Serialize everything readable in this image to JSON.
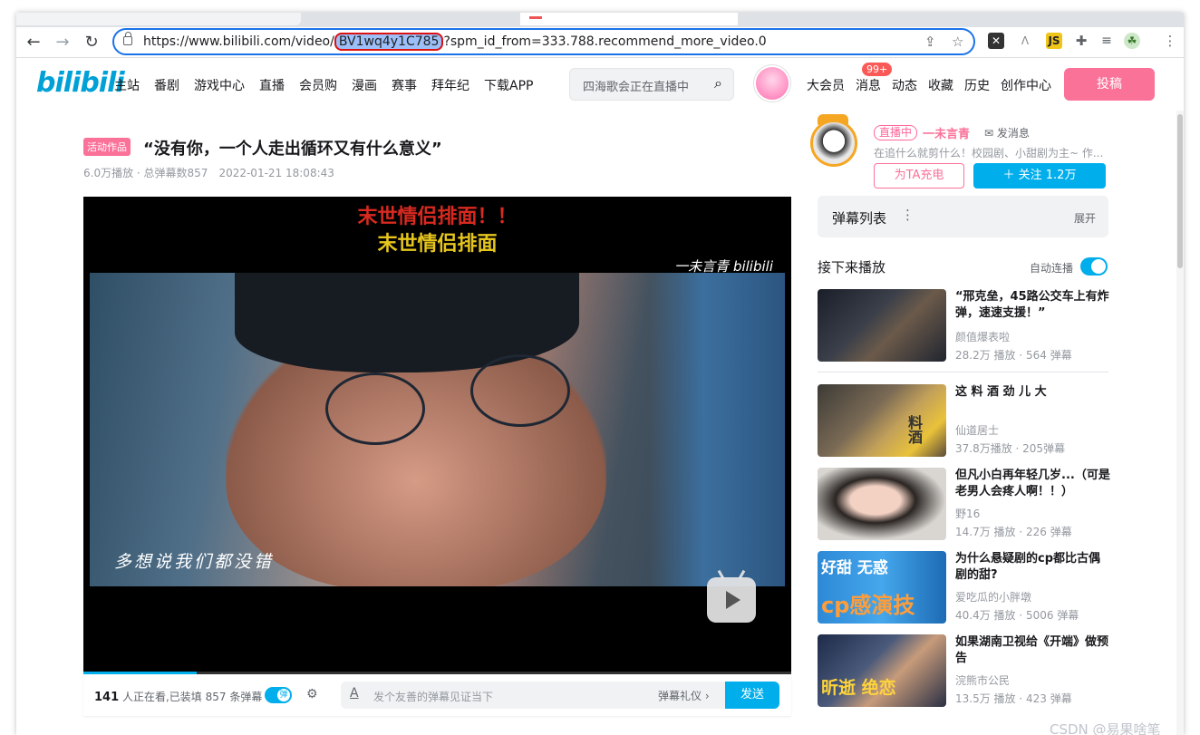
{
  "browser": {
    "url_prefix": "https://www.bilibili.com/video/",
    "url_highlight": "BV1wq4y1C785",
    "url_suffix": "?spm_id_from=333.788.recommend_more_video.0"
  },
  "header": {
    "logo": "bilibili",
    "nav": [
      "主站",
      "番剧",
      "游戏中心",
      "直播",
      "会员购",
      "漫画",
      "赛事",
      "拜年纪",
      "下载APP"
    ],
    "search_placeholder": "四海歌会正在直播中",
    "right_nav": [
      "大会员",
      "消息",
      "动态",
      "收藏",
      "历史",
      "创作中心"
    ],
    "message_badge": "99+",
    "upload": "投稿"
  },
  "video": {
    "tag": "活动作品",
    "title": "“没有你，一个人走出循环又有什么意义”",
    "views": "6.0万播放 · 总弹幕数857",
    "date": "2022-01-21 18:08:43",
    "caption_red": "末世情侣排面！！",
    "caption_yellow": "末世情侣排面",
    "watermark": "一未言青 bilibili",
    "subtitle": "多想说我们都没错",
    "progress": 0.16
  },
  "danmaku_bar": {
    "viewers_count": "141",
    "viewers_text": "人正在看,已装填 857 条弹幕",
    "toggle_label": "弹",
    "placeholder": "发个友善的弹幕见证当下",
    "etiquette": "弹幕礼仪 ›",
    "send": "发送"
  },
  "uploader": {
    "live": "直播中",
    "name": "一未言青",
    "message": "发消息",
    "desc": "在追什么就剪什么！校园剧、小甜剧为主~ 作...",
    "charge": "为TA充电",
    "follow": "＋  关注 1.2万"
  },
  "danmaku_list": {
    "title": "弹幕列表",
    "expand": "展开"
  },
  "next": {
    "title": "接下来播放",
    "autoplay": "自动连播"
  },
  "recommendations": [
    {
      "title": "“邢克垒，45路公交车上有炸弹，速速支援！”",
      "author": "颜值爆表啦",
      "stats": "28.2万 播放 · 564 弹幕",
      "overlay": ""
    },
    {
      "title": "这 料 酒 劲 儿 大",
      "author": "仙道居士",
      "stats": "37.8万播放 · 205弹幕",
      "overlay": "料酒"
    },
    {
      "title": "但凡小白再年轻几岁...（可是老男人会疼人啊！！）",
      "author": "野16",
      "stats": "14.7万 播放 · 226 弹幕",
      "overlay": ""
    },
    {
      "title": "为什么悬疑剧的cp都比古偶剧的甜?",
      "author": "爱吃瓜的小胖墩",
      "stats": "40.4万 播放 · 5006 弹幕",
      "overlay": "cp感演技",
      "overlay_top": "好甜 无惑"
    },
    {
      "title": "如果湖南卫视给《开端》做预告",
      "author": "浣熊市公民",
      "stats": "13.5万 播放 · 423 弹幕",
      "overlay": "昕逝 绝恋"
    }
  ],
  "watermark": "CSDN @易果啥笔"
}
